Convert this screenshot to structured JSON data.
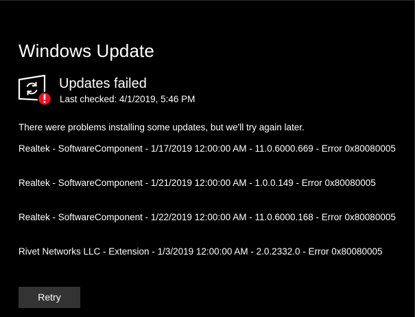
{
  "page": {
    "title": "Windows Update"
  },
  "status": {
    "icon": "update-failed-icon",
    "title": "Updates failed",
    "last_checked": "Last checked: 4/1/2019, 5:46 PM",
    "message": "There were problems installing some updates, but we'll try again later."
  },
  "updates": [
    {
      "text": "Realtek - SoftwareComponent - 1/17/2019 12:00:00 AM - 11.0.6000.669 - Error 0x80080005"
    },
    {
      "text": "Realtek - SoftwareComponent - 1/21/2019 12:00:00 AM - 1.0.0.149 - Error 0x80080005"
    },
    {
      "text": "Realtek - SoftwareComponent - 1/22/2019 12:00:00 AM - 11.0.6000.168 - Error 0x80080005"
    },
    {
      "text": "Rivet Networks LLC - Extension - 1/3/2019 12:00:00 AM - 2.0.2332.0 - Error 0x80080005"
    }
  ],
  "actions": {
    "retry_label": "Retry"
  },
  "colors": {
    "background": "#000000",
    "text": "#ffffff",
    "error_badge": "#e81123",
    "button_background": "#333333"
  }
}
